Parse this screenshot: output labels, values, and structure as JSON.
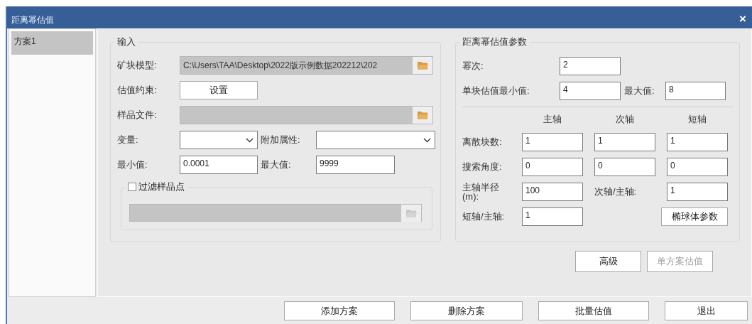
{
  "window": {
    "title": "距离幂估值",
    "close": "×"
  },
  "schemes": [
    {
      "label": "方案1",
      "selected": true
    }
  ],
  "input_group": {
    "title": "输入",
    "block_model": {
      "label": "矿块模型:",
      "value": "C:\\Users\\TAA\\Desktop\\2022版示例数据202212\\202"
    },
    "constraint": {
      "label": "估值约束:",
      "button": "设置"
    },
    "sample_file": {
      "label": "样品文件:"
    },
    "variable": {
      "label": "变量:"
    },
    "extra_attribute": {
      "label": "附加属性:"
    },
    "min": {
      "label": "最小值:",
      "value": "0.0001"
    },
    "max": {
      "label": "最大值:",
      "value": "9999"
    },
    "filter": {
      "label": "过滤样品点",
      "checked": false
    }
  },
  "params_group": {
    "title": "距离幂估值参数",
    "power": {
      "label": "幂次:",
      "value": "2"
    },
    "block_min": {
      "label": "单块估值最小值:",
      "value": "4"
    },
    "block_max": {
      "label": "最大值:",
      "value": "8"
    },
    "axis_headers": [
      "主轴",
      "次轴",
      "短轴"
    ],
    "grid_rows": [
      {
        "label": "离散块数:",
        "values": [
          "1",
          "1",
          "1"
        ]
      },
      {
        "label": "搜索角度:",
        "values": [
          "0",
          "0",
          "0"
        ]
      }
    ],
    "major_radius": {
      "label": "主轴半径\n(m):",
      "value": "100"
    },
    "semi_ratio": {
      "label": "次轴/主轴:",
      "value": "1"
    },
    "minor_ratio": {
      "label": "短轴/主轴:",
      "value": "1"
    },
    "ellipsoid_button": "椭球体参数"
  },
  "actions": [
    {
      "label": "高级",
      "disabled": false
    },
    {
      "label": "单方案估值",
      "disabled": true
    }
  ],
  "bottom_buttons": [
    "添加方案",
    "删除方案",
    "批量估值",
    "退出"
  ]
}
